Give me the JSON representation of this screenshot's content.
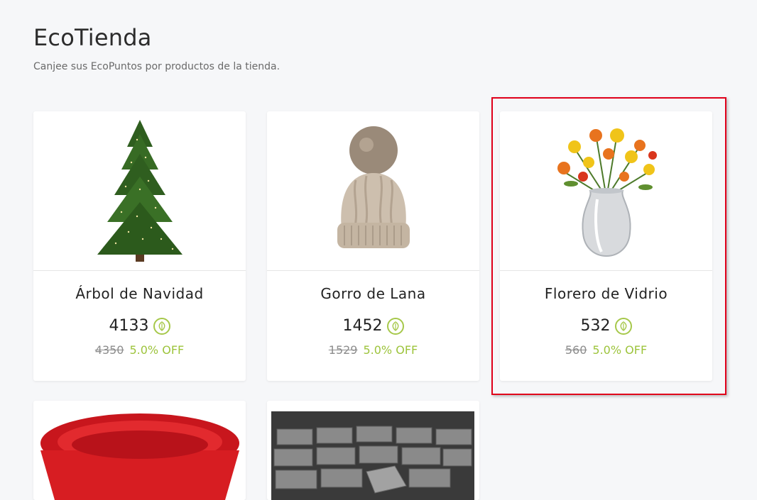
{
  "page": {
    "title": "EcoTienda",
    "subtitle": "Canjee sus EcoPuntos por productos de la tienda."
  },
  "colors": {
    "accent_green": "#9dc43c",
    "highlight_red": "#e0001a",
    "background": "#f6f7f9"
  },
  "products": [
    {
      "name": "Árbol de Navidad",
      "points": "4133",
      "original_points": "4350",
      "discount": "5.0% OFF",
      "image_icon": "christmas-tree-image"
    },
    {
      "name": "Gorro de Lana",
      "points": "1452",
      "original_points": "1529",
      "discount": "5.0% OFF",
      "image_icon": "wool-hat-image"
    },
    {
      "name": "Florero de Vidrio",
      "points": "532",
      "original_points": "560",
      "discount": "5.0% OFF",
      "image_icon": "flower-vase-image"
    },
    {
      "image_icon": "red-bowl-image"
    },
    {
      "image_icon": "concrete-blocks-image"
    }
  ]
}
